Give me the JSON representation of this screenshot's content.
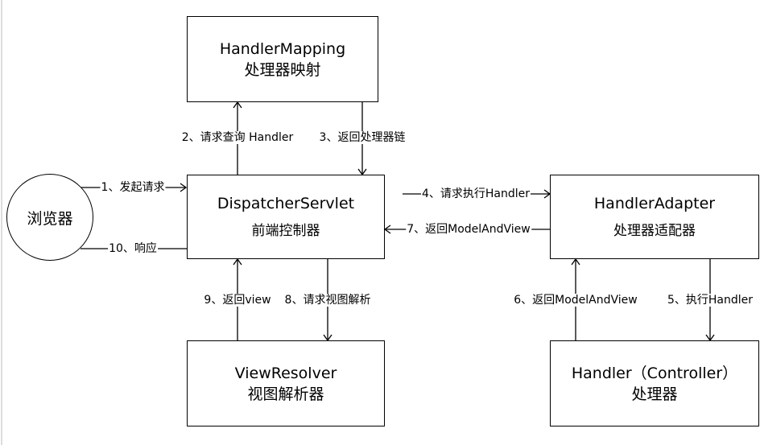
{
  "nodes": {
    "browser": {
      "label": "浏览器"
    },
    "handler_mapping": {
      "title": "HandlerMapping",
      "subtitle": "处理器映射"
    },
    "dispatcher": {
      "title": "DispatcherServlet",
      "subtitle": "前端控制器"
    },
    "handler_adapter": {
      "title": "HandlerAdapter",
      "subtitle": "处理器适配器"
    },
    "view_resolver": {
      "title": "ViewResolver",
      "subtitle": "视图解析器"
    },
    "handler": {
      "title": "Handler（Controller）",
      "subtitle": "处理器"
    }
  },
  "edges": {
    "e1": "1、发起请求",
    "e2": "2、请求查询 Handler",
    "e3": "3、返回处理器链",
    "e4": "4、请求执行Handler",
    "e5": "5、执行Handler",
    "e6": "6、返回ModelAndView",
    "e7": "7、返回ModelAndView",
    "e8": "8、请求视图解析",
    "e9": "9、返回view",
    "e10": "10、响应"
  }
}
